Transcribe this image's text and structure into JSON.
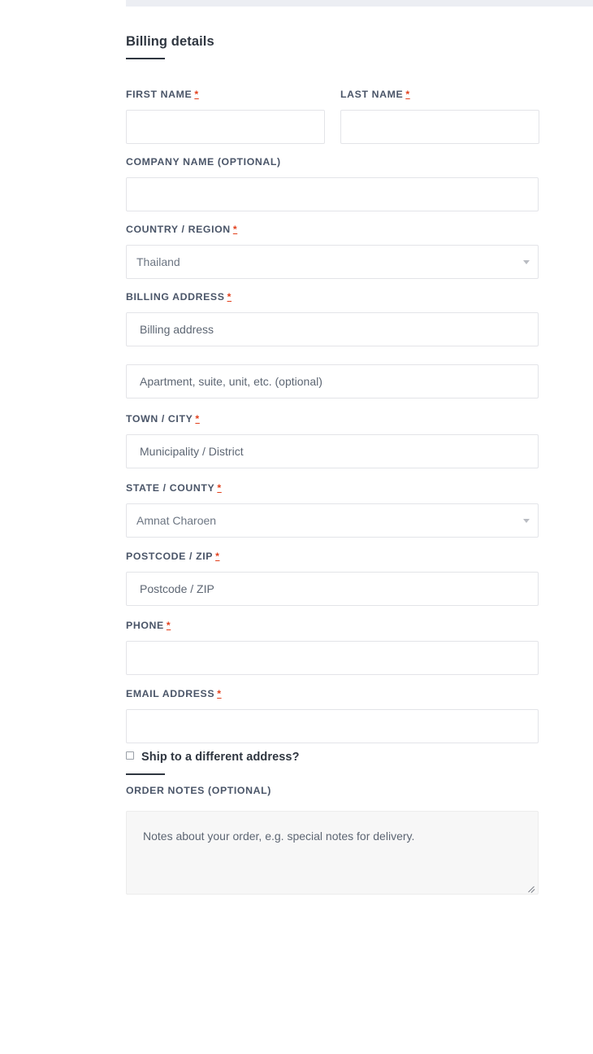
{
  "section": {
    "title": "Billing details"
  },
  "fields": {
    "first_name": {
      "label": "FIRST NAME",
      "required": true,
      "value": "",
      "placeholder": ""
    },
    "last_name": {
      "label": "LAST NAME",
      "required": true,
      "value": "",
      "placeholder": ""
    },
    "company_name": {
      "label": "COMPANY NAME (OPTIONAL)",
      "required": false,
      "value": "",
      "placeholder": ""
    },
    "country_region": {
      "label": "COUNTRY / REGION",
      "required": true,
      "selected": "Thailand"
    },
    "billing_address": {
      "label": "BILLING ADDRESS",
      "required": true,
      "value": "",
      "placeholder": "Billing address"
    },
    "address_line_2": {
      "label": "",
      "required": false,
      "value": "",
      "placeholder": "Apartment, suite, unit, etc. (optional)"
    },
    "town_city": {
      "label": "TOWN / CITY",
      "required": true,
      "value": "",
      "placeholder": "Municipality / District"
    },
    "state_county": {
      "label": "STATE / COUNTY",
      "required": true,
      "selected": "Amnat Charoen"
    },
    "postcode_zip": {
      "label": "POSTCODE / ZIP",
      "required": true,
      "value": "",
      "placeholder": "Postcode / ZIP"
    },
    "phone": {
      "label": "PHONE",
      "required": true,
      "value": "",
      "placeholder": ""
    },
    "email_address": {
      "label": "EMAIL ADDRESS",
      "required": true,
      "value": "",
      "placeholder": ""
    },
    "order_notes": {
      "label": "ORDER NOTES (OPTIONAL)",
      "required": false,
      "value": "",
      "placeholder": "Notes about your order, e.g. special notes for delivery."
    }
  },
  "ship_different": {
    "label": "Ship to a different address?",
    "checked": false
  },
  "required_marker": "*",
  "icons": {
    "country_caret": "chevron-down-icon",
    "state_caret": "chevron-down-icon",
    "resize_grip": "resize-handle-icon",
    "checkbox": "checkbox-unchecked-icon"
  },
  "colors": {
    "required_red": "#e2401c",
    "heading": "#2f3640",
    "label": "#4a5568",
    "placeholder": "#5d6673",
    "input_border": "#e3e4e8",
    "textarea_bg": "#f7f7f7",
    "top_band": "#eceef3"
  }
}
